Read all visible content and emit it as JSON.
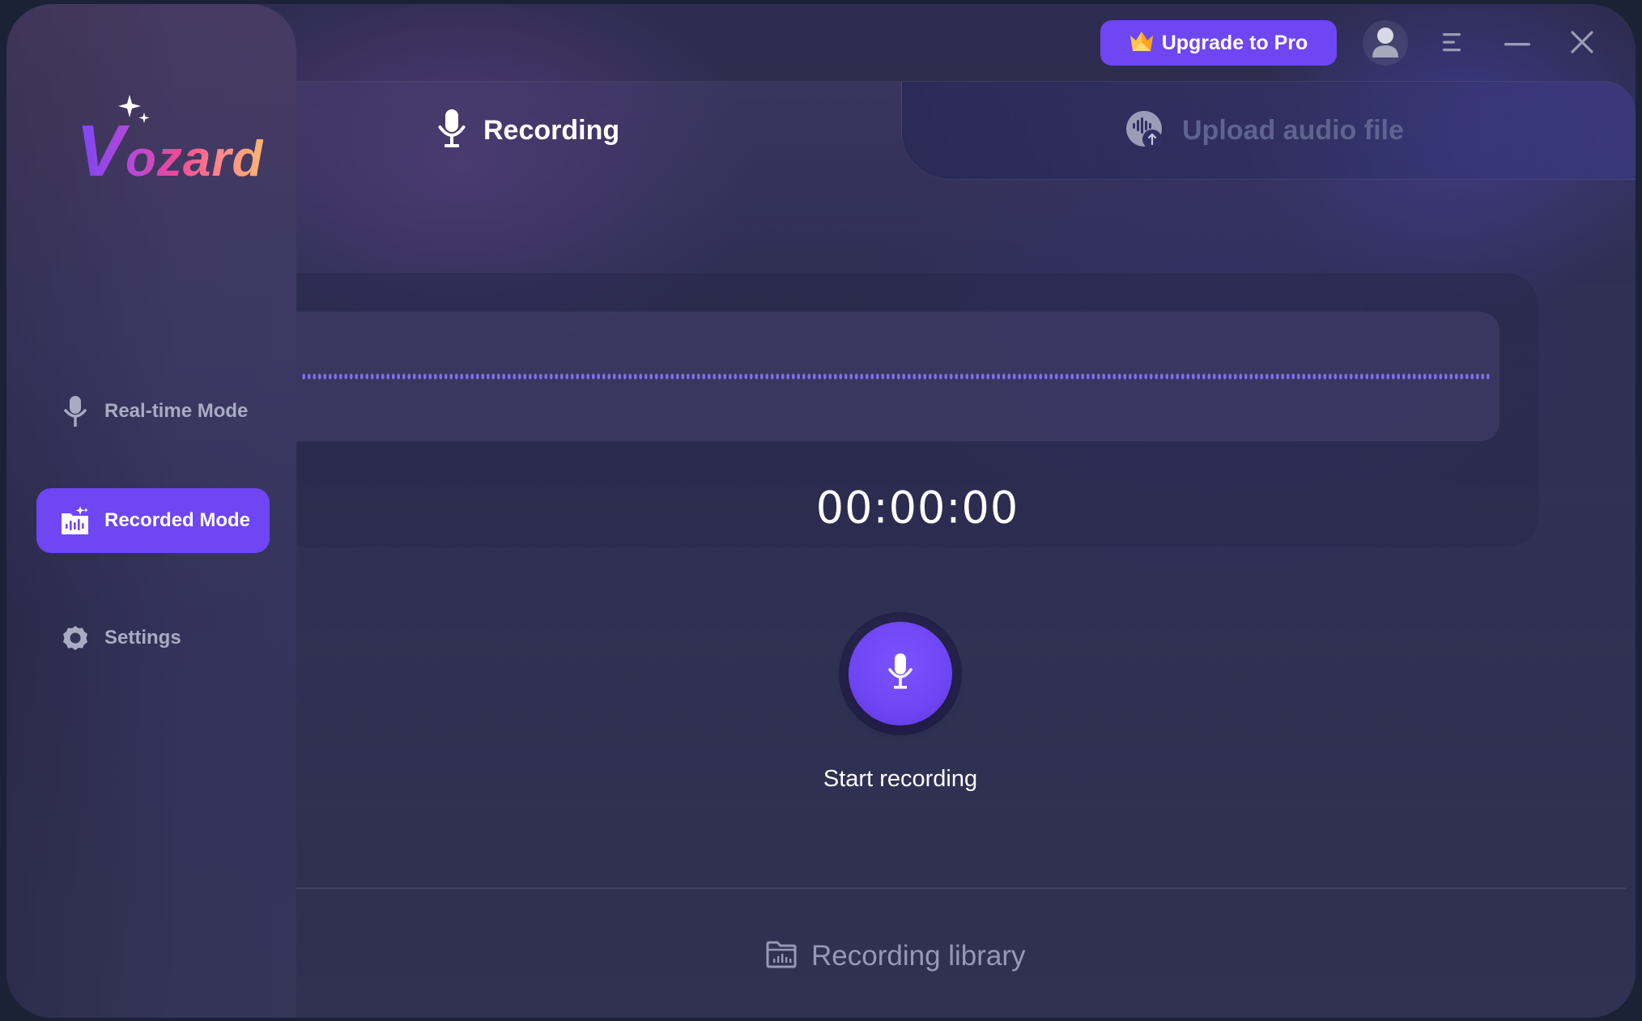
{
  "app": {
    "name": "Vozard",
    "logo_first_letter": "V",
    "logo_rest": "ozard",
    "accent_color": "#6e46f4"
  },
  "topbar": {
    "upgrade_label": "Upgrade to Pro",
    "upgrade_icon": "crown-icon",
    "avatar_icon": "user-avatar-icon",
    "menu_icon": "hamburger-menu-icon",
    "minimize_icon": "minimize-icon",
    "close_icon": "close-icon"
  },
  "sidebar": {
    "items": [
      {
        "label": "Real-time Mode",
        "icon": "microphone-icon",
        "active": false
      },
      {
        "label": "Recorded Mode",
        "icon": "recorded-folder-icon",
        "active": true
      },
      {
        "label": "Settings",
        "icon": "gear-icon",
        "active": false
      }
    ]
  },
  "tabs": [
    {
      "label": "Recording",
      "icon": "microphone-icon",
      "active": true
    },
    {
      "label": "Upload audio file",
      "icon": "upload-audio-icon",
      "active": false
    }
  ],
  "recorder": {
    "timer": "00:00:00",
    "start_label": "Start recording",
    "button_icon": "microphone-icon"
  },
  "footer": {
    "library_label": "Recording library",
    "library_icon": "folder-chart-icon"
  }
}
